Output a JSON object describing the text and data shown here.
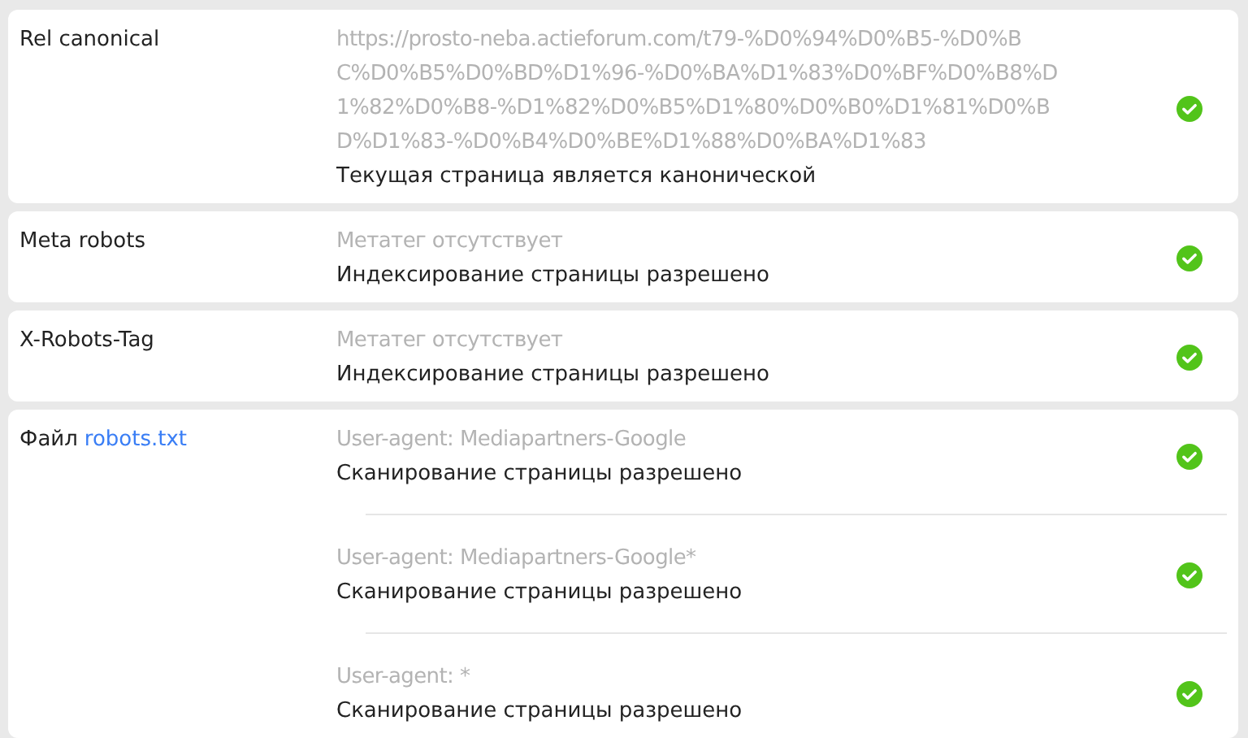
{
  "checks": [
    {
      "label": "Rel canonical",
      "entries": [
        {
          "detail_lines": [
            "https://prosto-neba.actieforum.com/t79-%D0%94%D0%B5-%D0%B",
            "C%D0%B5%D0%BD%D1%96-%D0%BA%D1%83%D0%BF%D0%B8%D",
            "1%82%D0%B8-%D1%82%D0%B5%D1%80%D0%B0%D1%81%D0%B",
            "D%D1%83-%D0%B4%D0%BE%D1%88%D0%BA%D1%83"
          ],
          "result": "Текущая страница является канонической",
          "passed": true
        }
      ]
    },
    {
      "label": "Meta robots",
      "entries": [
        {
          "detail_lines": [
            "Метатег отсутствует"
          ],
          "result": "Индексирование страницы разрешено",
          "passed": true
        }
      ]
    },
    {
      "label": "X-Robots-Tag",
      "entries": [
        {
          "detail_lines": [
            "Метатег отсутствует"
          ],
          "result": "Индексирование страницы разрешено",
          "passed": true
        }
      ]
    },
    {
      "label": "Файл",
      "link": "robots.txt",
      "entries": [
        {
          "detail_lines": [
            "User-agent: Mediapartners-Google"
          ],
          "result": "Сканирование страницы разрешено",
          "passed": true
        },
        {
          "detail_lines": [
            "User-agent: Mediapartners-Google*"
          ],
          "result": "Сканирование страницы разрешено",
          "passed": true
        },
        {
          "detail_lines": [
            "User-agent: *"
          ],
          "result": "Сканирование страницы разрешено",
          "passed": true
        }
      ]
    }
  ]
}
